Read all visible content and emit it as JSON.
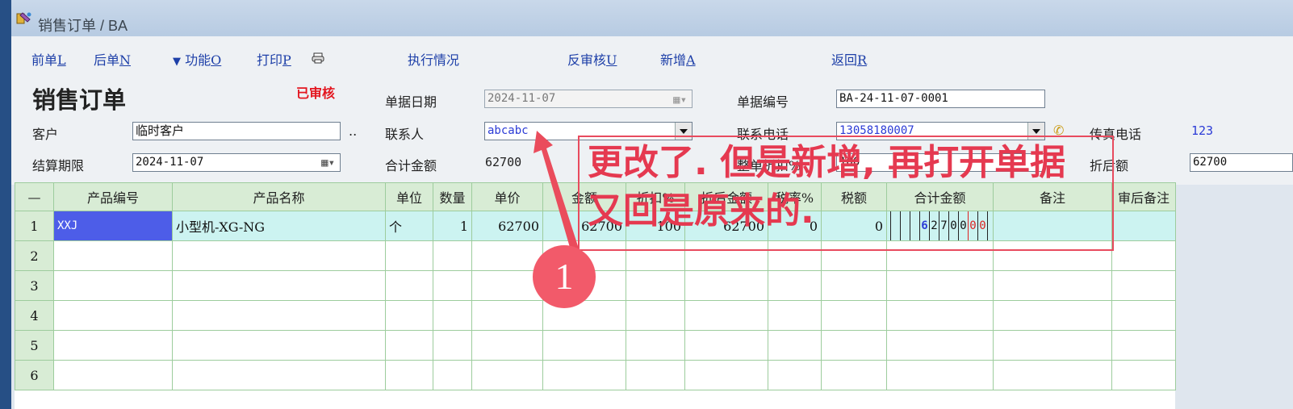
{
  "window": {
    "title": "销售订单 / BA"
  },
  "toolbar": {
    "prev": "前单",
    "prev_key": "L",
    "next": "后单",
    "next_key": "N",
    "function": "功能",
    "function_key": "O",
    "print": "打印",
    "print_key": "P",
    "execution": "执行情况",
    "unapprove": "反审核",
    "unapprove_key": "U",
    "add": "新增",
    "add_key": "A",
    "back": "返回",
    "back_key": "R"
  },
  "form": {
    "heading": "销售订单",
    "status": "已审核",
    "date_label": "单据日期",
    "date_value": "2024-11-07",
    "docno_label": "单据编号",
    "docno_value": "BA-24-11-07-0001",
    "customer_label": "客户",
    "customer_value": "临时客户",
    "customer_more": "..",
    "contact_label": "联系人",
    "contact_value": "abcabc",
    "phone_label": "联系电话",
    "phone_value": "13058180007",
    "fax_label": "传真电话",
    "fax_value": "123",
    "settle_label": "结算期限",
    "settle_value": "2024-11-07",
    "total_label": "合计金额",
    "total_value": "62700",
    "discount_label": "整单折扣%",
    "discount_value": "100",
    "after_label": "折后额",
    "after_value": "62700"
  },
  "grid": {
    "corner": "—",
    "headers": [
      "产品编号",
      "产品名称",
      "单位",
      "数量",
      "单价",
      "金额",
      "折扣%",
      "折后金额",
      "税率%",
      "税额",
      "合计金额",
      "备注",
      "审后备注"
    ],
    "rows": [
      {
        "no": "1",
        "code": "XXJ",
        "name": "小型机-XG-NG",
        "unit": "个",
        "qty": "1",
        "price": "62700",
        "amount": "62700",
        "disc": "100",
        "after": "62700",
        "rate": "0",
        "tax": "0",
        "total_digits": [
          "6",
          "2",
          "7",
          "0",
          "0",
          "0",
          "0"
        ]
      },
      {
        "no": "2"
      },
      {
        "no": "3"
      },
      {
        "no": "4"
      },
      {
        "no": "5"
      },
      {
        "no": "6"
      }
    ]
  },
  "annotation": {
    "text_line1": "更改了. 但是新增, 再打开单据",
    "text_line2": "又回是原来的.",
    "marker": "1",
    "color": "#e53950"
  }
}
